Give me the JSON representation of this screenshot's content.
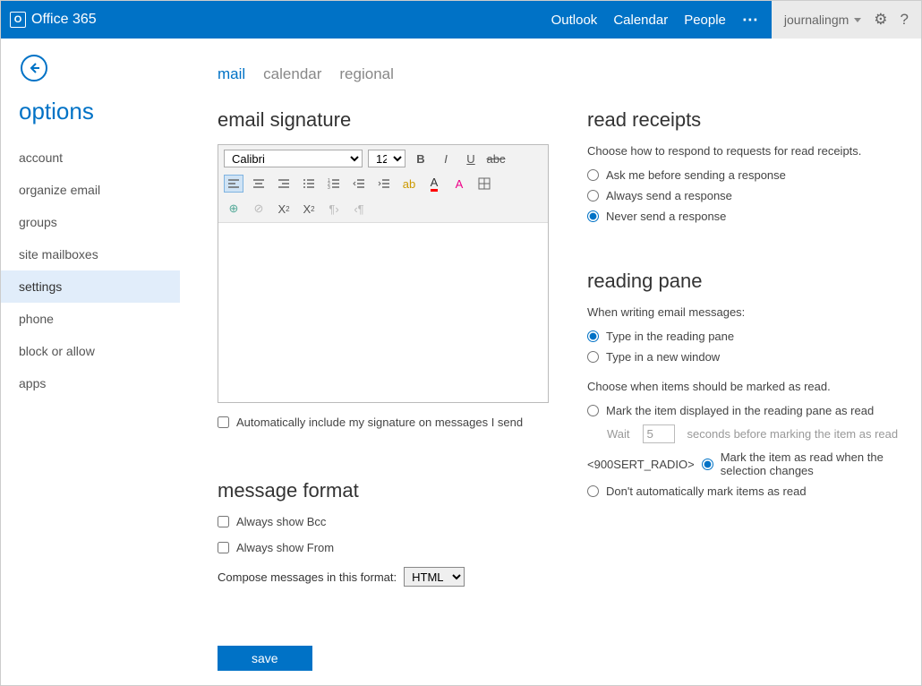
{
  "brand": "Office 365",
  "topnav": {
    "outlook": "Outlook",
    "calendar": "Calendar",
    "people": "People"
  },
  "user": "journalingm",
  "options_title": "options",
  "sidebar": {
    "items": [
      {
        "label": "account"
      },
      {
        "label": "organize email"
      },
      {
        "label": "groups"
      },
      {
        "label": "site mailboxes"
      },
      {
        "label": "settings"
      },
      {
        "label": "phone"
      },
      {
        "label": "block or allow"
      },
      {
        "label": "apps"
      }
    ]
  },
  "tabs": {
    "mail": "mail",
    "calendar": "calendar",
    "regional": "regional"
  },
  "signature": {
    "heading": "email signature",
    "font": "Calibri",
    "size": "12",
    "auto_include_label": "Automatically include my signature on messages I send",
    "auto_include": false
  },
  "message_format": {
    "heading": "message format",
    "show_bcc_label": "Always show Bcc",
    "show_bcc": false,
    "show_from_label": "Always show From",
    "show_from": false,
    "compose_label": "Compose messages in this format:",
    "compose_value": "HTML"
  },
  "read_receipts": {
    "heading": "read receipts",
    "desc": "Choose how to respond to requests for read receipts.",
    "opt_ask": "Ask me before sending a response",
    "opt_always": "Always send a response",
    "opt_never": "Never send a response",
    "selected": "never"
  },
  "reading_pane": {
    "heading": "reading pane",
    "writing_desc": "When writing email messages:",
    "opt_in_pane": "Type in the reading pane",
    "opt_new_window": "Type in a new window",
    "writing_selected": "pane",
    "mark_desc": "Choose when items should be marked as read.",
    "opt_mark_displayed": "Mark the item displayed in the reading pane as read",
    "wait_prefix": "Wait",
    "wait_value": "5",
    "wait_suffix": "seconds before marking the item as read",
    "opt_mark_selection": "Mark the item as read when the selection changes",
    "opt_mark_never": "Don't automatically mark items as read",
    "mark_selected": "selection"
  },
  "save_label": "save"
}
